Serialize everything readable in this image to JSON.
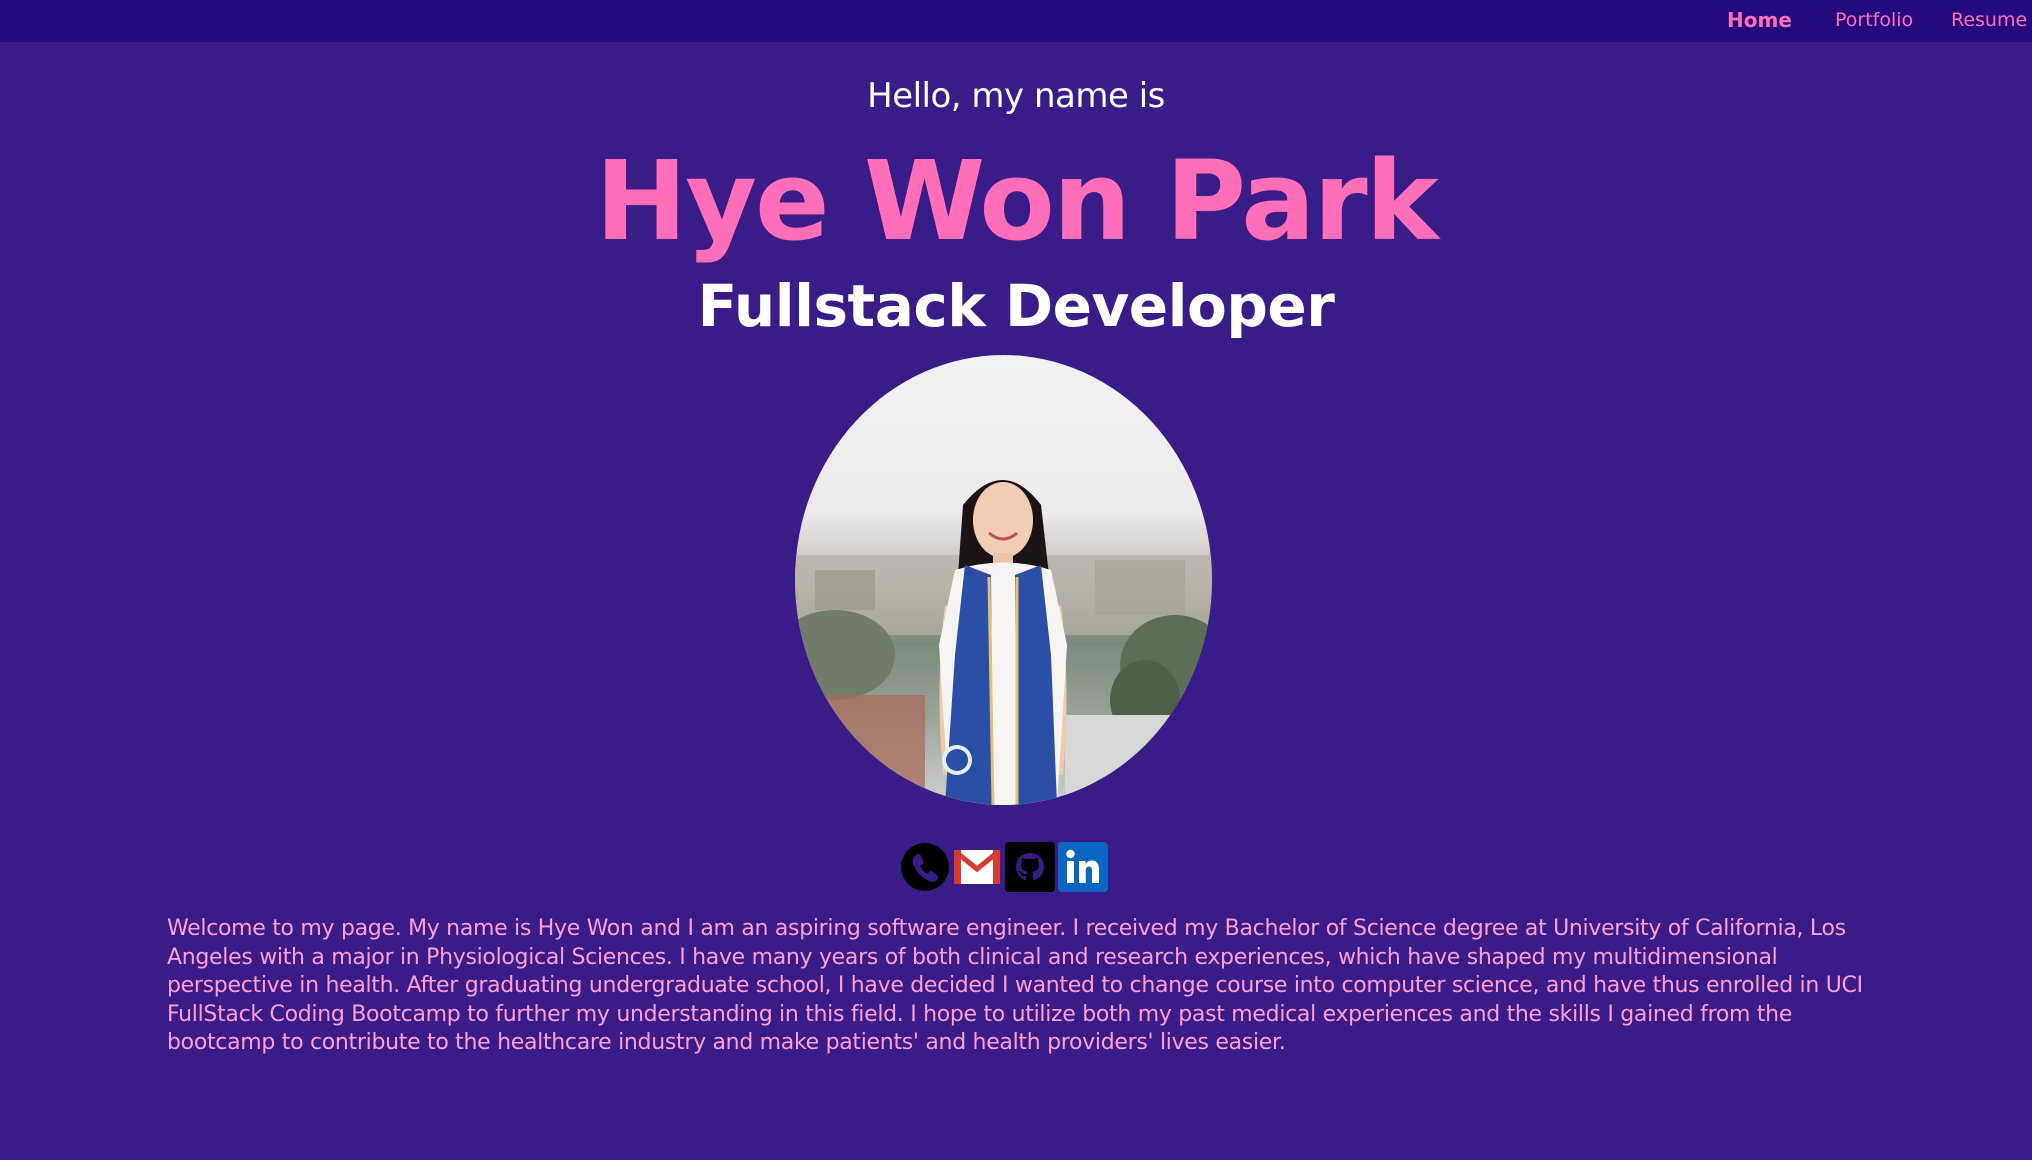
{
  "nav": {
    "items": [
      {
        "label": "Home",
        "active": true
      },
      {
        "label": "Portfolio",
        "active": false
      },
      {
        "label": "Resume",
        "active": false
      }
    ]
  },
  "hero": {
    "greeting": "Hello, my name is",
    "name": "Hye Won Park",
    "role": "Fullstack Developer"
  },
  "socials": [
    {
      "name": "phone",
      "icon": "phone-icon"
    },
    {
      "name": "email",
      "icon": "gmail-icon"
    },
    {
      "name": "github",
      "icon": "github-icon"
    },
    {
      "name": "linkedin",
      "icon": "linkedin-icon"
    }
  ],
  "bio": "Welcome to my page. My name is Hye Won and I am an aspiring software engineer. I received my Bachelor of Science degree at University of California, Los Angeles with a major in Physiological Sciences. I have many years of both clinical and research experiences, which have shaped my multidimensional perspective in health. After graduating undergraduate school, I have decided I wanted to change course into computer science, and have thus enrolled in UCI FullStack Coding Bootcamp to further my understanding in this field. I hope to utilize both my past medical experiences and the skills I gained from the bootcamp to contribute to the healthcare industry and make patients' and health providers' lives easier.",
  "colors": {
    "background": "#3a1c88",
    "navbar": "#25097f",
    "accent_pink": "#ff6eb9",
    "bio_text": "#ff9fd5",
    "heading_white": "#ffffff"
  }
}
